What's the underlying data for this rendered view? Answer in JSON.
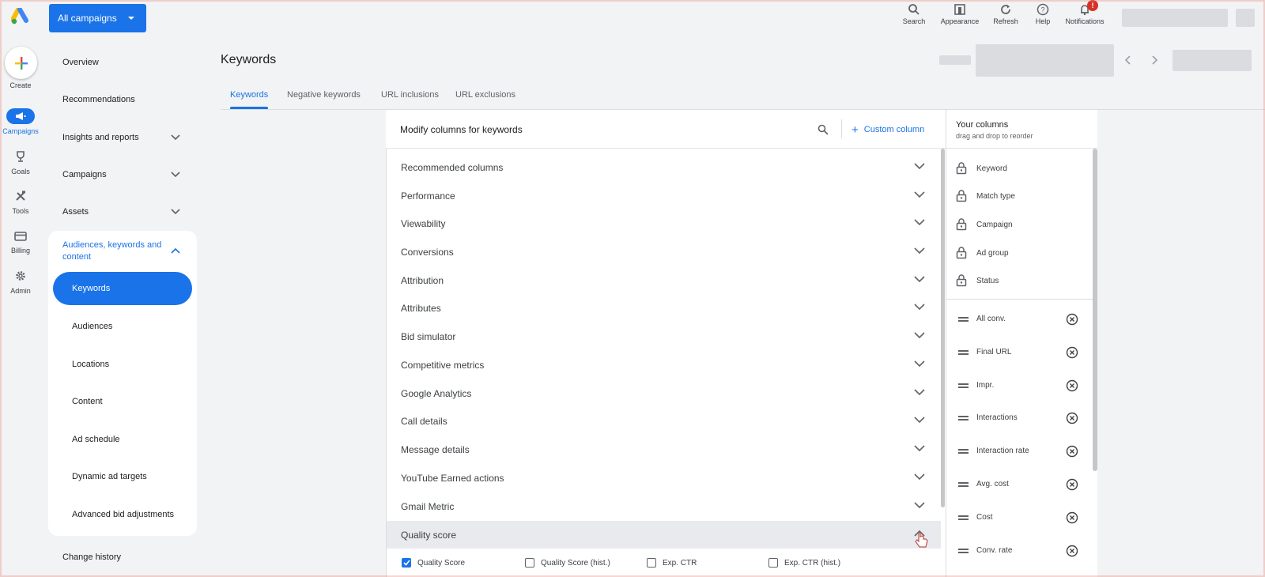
{
  "topbar": {
    "campaign_selector": "All campaigns",
    "tools": [
      {
        "icon": "search-icon",
        "label": "Search"
      },
      {
        "icon": "appearance-icon",
        "label": "Appearance"
      },
      {
        "icon": "refresh-icon",
        "label": "Refresh"
      },
      {
        "icon": "help-icon",
        "label": "Help"
      },
      {
        "icon": "bell-icon",
        "label": "Notifications",
        "badge": "!"
      }
    ]
  },
  "rail": {
    "create": "Create",
    "items": [
      {
        "icon": "megaphone-icon",
        "label": "Campaigns",
        "active": true
      },
      {
        "icon": "trophy-icon",
        "label": "Goals"
      },
      {
        "icon": "tools-icon",
        "label": "Tools"
      },
      {
        "icon": "credit-card-icon",
        "label": "Billing"
      },
      {
        "icon": "gear-icon",
        "label": "Admin"
      }
    ]
  },
  "nav": {
    "overview": "Overview",
    "recommendations": "Recommendations",
    "insights": "Insights and reports",
    "campaigns": "Campaigns",
    "assets": "Assets",
    "group_title": "Audiences, keywords and content",
    "sub_items": [
      "Keywords",
      "Audiences",
      "Locations",
      "Content",
      "Ad schedule",
      "Dynamic ad targets",
      "Advanced bid adjustments"
    ],
    "change_history": "Change history"
  },
  "page": {
    "title": "Keywords",
    "tabs": [
      "Keywords",
      "Negative keywords",
      "URL inclusions",
      "URL exclusions"
    ]
  },
  "panel": {
    "title": "Modify columns for keywords",
    "custom_column": "Custom column",
    "categories": [
      "Recommended columns",
      "Performance",
      "Viewability",
      "Conversions",
      "Attribution",
      "Attributes",
      "Bid simulator",
      "Competitive metrics",
      "Google Analytics",
      "Call details",
      "Message details",
      "YouTube Earned actions",
      "Gmail Metric",
      "Quality score"
    ],
    "quality_options": [
      {
        "label": "Quality Score",
        "checked": true
      },
      {
        "label": "Quality Score (hist.)",
        "checked": false
      },
      {
        "label": "Exp. CTR",
        "checked": false
      },
      {
        "label": "Exp. CTR (hist.)",
        "checked": false
      }
    ]
  },
  "your_columns": {
    "title": "Your columns",
    "subtitle": "drag and drop to reorder",
    "locked": [
      "Keyword",
      "Match type",
      "Campaign",
      "Ad group",
      "Status"
    ],
    "removable": [
      "All conv.",
      "Final URL",
      "Impr.",
      "Interactions",
      "Interaction rate",
      "Avg. cost",
      "Cost",
      "Conv. rate"
    ]
  },
  "colors": {
    "accent": "#1a73e8",
    "background": "#f1f3f4",
    "badge": "#d93025"
  }
}
